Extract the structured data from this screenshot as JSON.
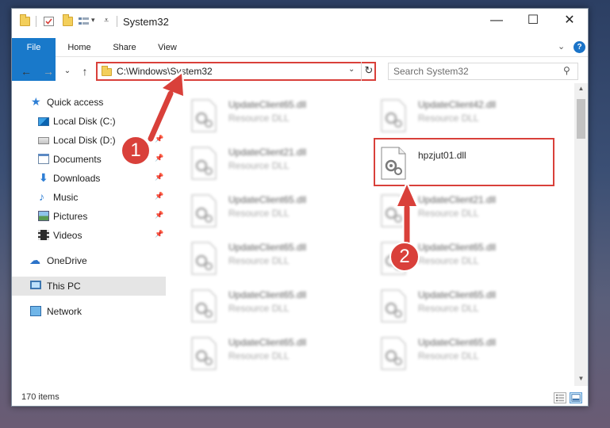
{
  "window": {
    "title": "System32",
    "controls": {
      "minimize": "—",
      "maximize": "☐",
      "close": "✕"
    }
  },
  "ribbon": {
    "tabs": [
      "File",
      "Home",
      "Share",
      "View"
    ],
    "expand_glyph": "⌄",
    "help_glyph": "?"
  },
  "nav": {
    "back": "←",
    "forward": "→",
    "recent": "⌄",
    "up": "↑",
    "address": "C:\\Windows\\System32",
    "address_dropdown": "⌄",
    "refresh": "↻",
    "search_placeholder": "Search System32",
    "search_glyph": "⚲"
  },
  "sidebar": {
    "pin_glyph": "📌",
    "items": [
      {
        "label": "Quick access"
      },
      {
        "label": "Local Disk (C:)"
      },
      {
        "label": "Local Disk (D:)"
      },
      {
        "label": "Documents"
      },
      {
        "label": "Downloads"
      },
      {
        "label": "Music"
      },
      {
        "label": "Pictures"
      },
      {
        "label": "Videos"
      },
      {
        "label": "OneDrive"
      },
      {
        "label": "This PC"
      },
      {
        "label": "Network"
      }
    ]
  },
  "files": [
    {
      "name": "UpdateClient65.dll",
      "type": "Resource DLL"
    },
    {
      "name": "UpdateClient42.dll",
      "type": "Resource DLL"
    },
    {
      "name": "UpdateClient21.dll",
      "type": "Resource DLL"
    },
    {
      "name": "hpzjut01.dll",
      "type": ""
    },
    {
      "name": "UpdateClient65.dll",
      "type": "Resource DLL"
    },
    {
      "name": "UpdateClient21.dll",
      "type": "Resource DLL"
    },
    {
      "name": "UpdateClient65.dll",
      "type": "Resource DLL"
    },
    {
      "name": "UpdateClient65.dll",
      "type": "Resource DLL"
    },
    {
      "name": "UpdateClient65.dll",
      "type": "Resource DLL"
    },
    {
      "name": "UpdateClient65.dll",
      "type": "Resource DLL"
    },
    {
      "name": "UpdateClient65.dll",
      "type": "Resource DLL"
    },
    {
      "name": "UpdateClient65.dll",
      "type": "Resource DLL"
    }
  ],
  "scrollbar": {
    "up": "▲",
    "down": "▼"
  },
  "status": {
    "item_count": "170 items"
  },
  "callouts": {
    "step1": "1",
    "step2": "2"
  },
  "colors": {
    "accent": "#1979ca",
    "callout": "#d9403a"
  }
}
